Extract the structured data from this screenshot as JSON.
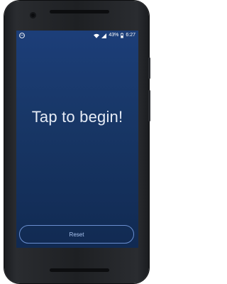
{
  "status_bar": {
    "battery_percent": "43%",
    "time": "6:27",
    "icons": [
      "app-notification-icon",
      "wifi-icon",
      "signal-icon",
      "battery-icon"
    ]
  },
  "main": {
    "headline": "Tap to begin!",
    "reset_label": "Reset"
  },
  "colors": {
    "background_top": "#1c3e79",
    "background_bottom": "#112a52",
    "button_border": "#6a8fd0",
    "text": "#e6ecf6"
  }
}
